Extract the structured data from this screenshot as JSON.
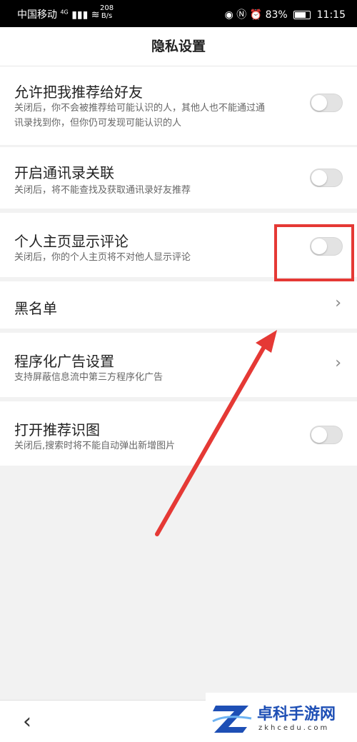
{
  "status_bar": {
    "carrier": "中国移动",
    "network_type": "4G",
    "speed_value": "208",
    "speed_unit": "B/s",
    "battery": "83%",
    "time": "11:15"
  },
  "header": {
    "title": "隐私设置"
  },
  "settings": [
    {
      "title": "允许把我推荐给好友",
      "desc": "关闭后，你不会被推荐给可能认识的人，其他人也不能通过通讯录找到你，但你仍可发现可能认识的人",
      "control": "toggle",
      "on": false
    },
    {
      "title": "开启通讯录关联",
      "desc": "关闭后，将不能查找及获取通讯录好友推荐",
      "control": "toggle",
      "on": false
    },
    {
      "title": "个人主页显示评论",
      "desc": "关闭后，你的个人主页将不对他人显示评论",
      "control": "toggle",
      "on": false
    },
    {
      "title": "黑名单",
      "desc": "",
      "control": "chevron"
    },
    {
      "title": "程序化广告设置",
      "desc": "支持屏蔽信息流中第三方程序化广告",
      "control": "chevron"
    },
    {
      "title": "打开推荐识图",
      "desc": "关闭后,搜索时将不能自动弹出新增图片",
      "control": "toggle",
      "on": false
    }
  ],
  "annotation": {
    "color": "#e53935"
  },
  "bottom_nav": {
    "back_icon": "chevron-left-icon"
  },
  "watermark": {
    "name": "卓科手游网",
    "url": "zkhcedu.com",
    "brand_color": "#1e4fb5"
  }
}
